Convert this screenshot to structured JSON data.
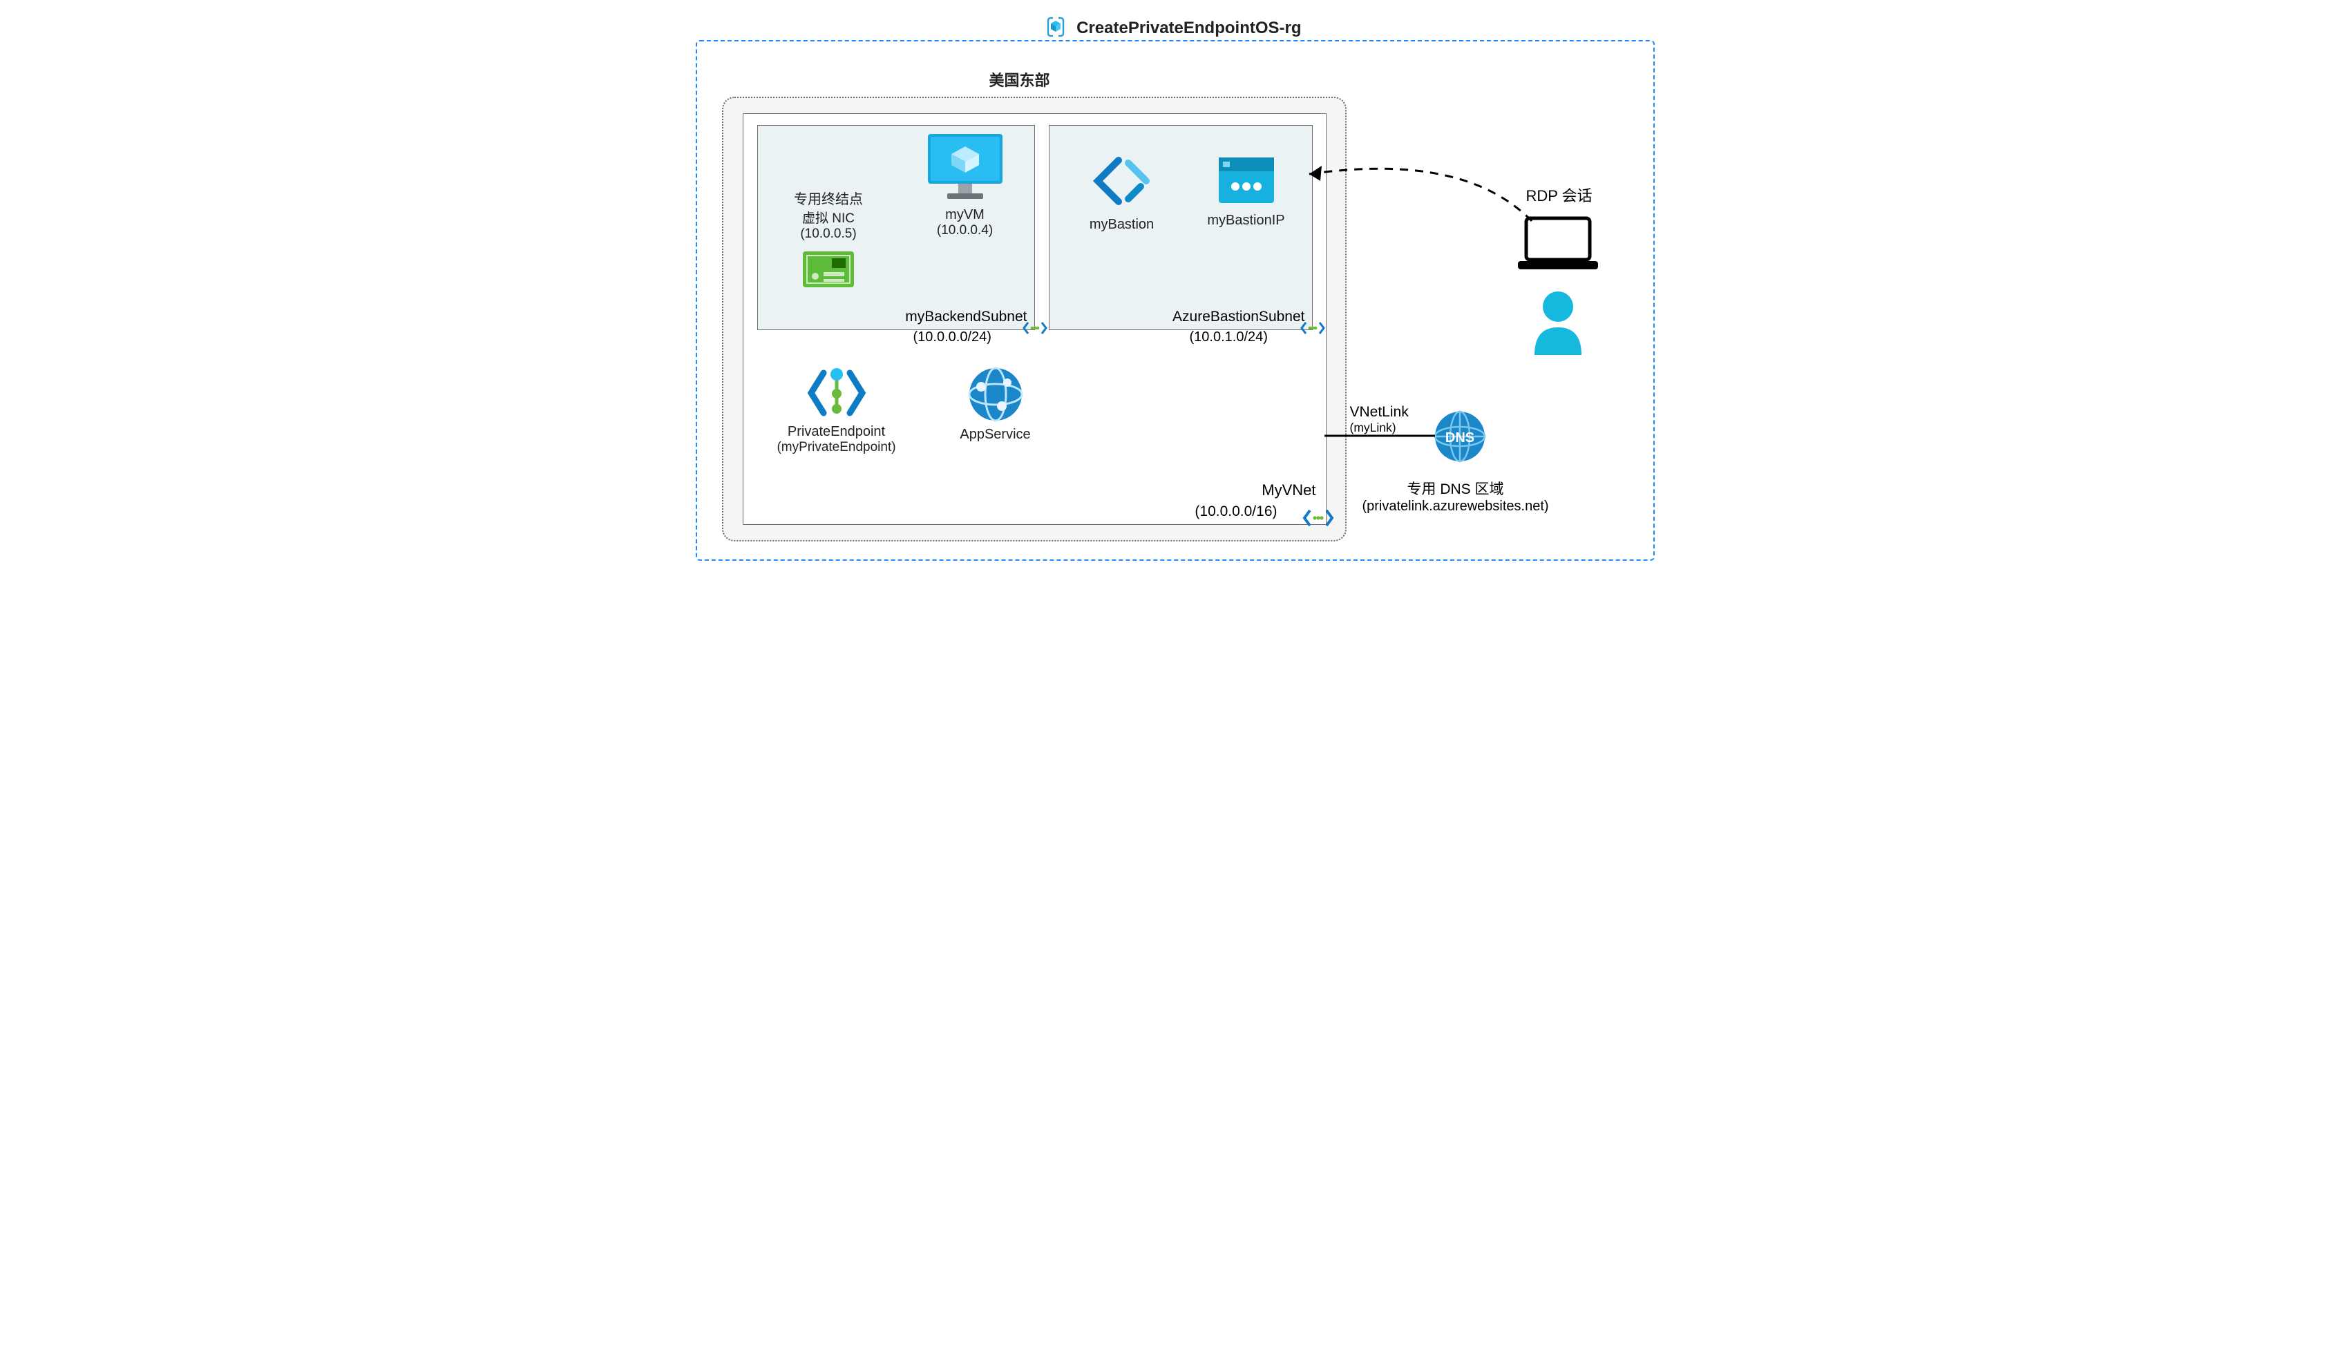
{
  "resourceGroup": {
    "title": "CreatePrivateEndpointOS-rg"
  },
  "region": {
    "label": "美国东部"
  },
  "vnet": {
    "name": "MyVNet",
    "cidr": "(10.0.0.0/16)"
  },
  "subnet1": {
    "name": "myBackendSubnet",
    "cidr": "(10.0.0.0/24)"
  },
  "subnet2": {
    "name": "AzureBastionSubnet",
    "cidr": "(10.0.1.0/24)"
  },
  "nic": {
    "line1": "专用终结点",
    "line2": "虚拟 NIC",
    "ip": "(10.0.0.5)"
  },
  "vm": {
    "name": "myVM",
    "ip": "(10.0.0.4)"
  },
  "bastion": {
    "name": "myBastion"
  },
  "bastionIp": {
    "name": "myBastionIP"
  },
  "privateEndpoint": {
    "line1": "PrivateEndpoint",
    "line2": "(myPrivateEndpoint)"
  },
  "appService": {
    "name": "AppService"
  },
  "rdp": {
    "label": "RDP 会话"
  },
  "vnetLink": {
    "line1": "VNetLink",
    "line2": "(myLink)"
  },
  "dns": {
    "line1": "专用 DNS 区域",
    "line2": "(privatelink.azurewebsites.net)"
  }
}
